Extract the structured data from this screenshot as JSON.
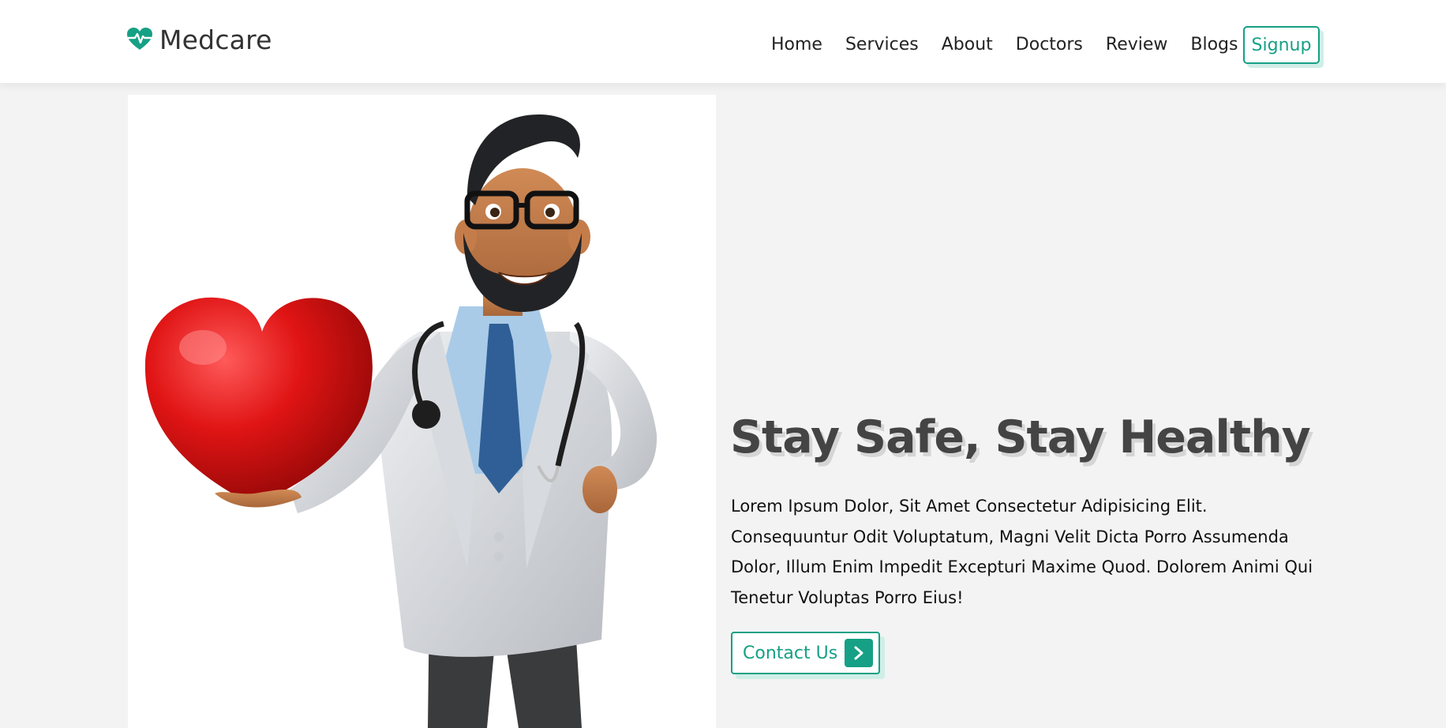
{
  "brand": {
    "name": "Medcare",
    "icon": "heartbeat-icon",
    "accent_color": "#16a085"
  },
  "nav": {
    "items": [
      {
        "label": "Home"
      },
      {
        "label": "Services"
      },
      {
        "label": "About"
      },
      {
        "label": "Doctors"
      },
      {
        "label": "Review"
      },
      {
        "label": "Blogs"
      }
    ],
    "signup_label": "Signup"
  },
  "hero": {
    "title": "Stay Safe, Stay Healthy",
    "text": "Lorem Ipsum Dolor, Sit Amet Consectetur Adipisicing Elit. Consequuntur Odit Voluptatum, Magni Velit Dicta Porro Assumenda Dolor, Illum Enim Impedit Excepturi Maxime Quod. Dolorem Animi Qui Tenetur Voluptas Porro Eius!",
    "cta_label": "Contact Us",
    "cta_icon": "chevron-right-icon",
    "image_subject": "doctor-holding-heart-illustration"
  }
}
